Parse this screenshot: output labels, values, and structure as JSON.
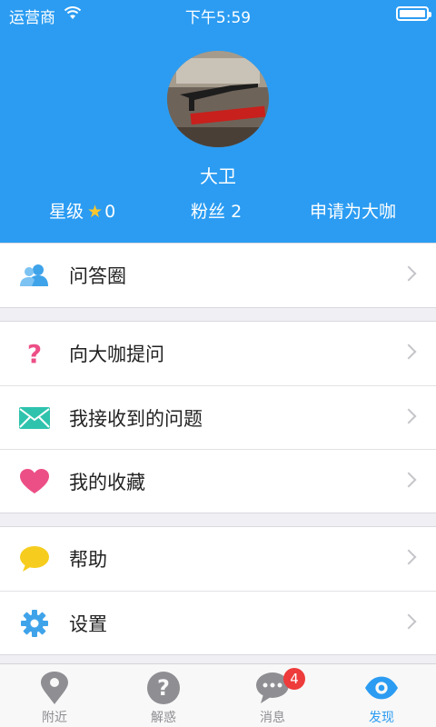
{
  "status_bar": {
    "carrier": "运营商",
    "time": "下午5:59"
  },
  "profile": {
    "name": "大卫",
    "level_label": "星级",
    "level_value": "0",
    "fans_label": "粉丝",
    "fans_value": "2",
    "apply_label": "申请为大咖"
  },
  "menu": {
    "group1": [
      {
        "label": "问答圈",
        "icon": "users-icon"
      }
    ],
    "group2": [
      {
        "label": "向大咖提问",
        "icon": "question-mark-icon"
      },
      {
        "label": "我接收到的问题",
        "icon": "envelope-icon"
      },
      {
        "label": "我的收藏",
        "icon": "heart-icon"
      }
    ],
    "group3": [
      {
        "label": "帮助",
        "icon": "speech-bubble-icon"
      },
      {
        "label": "设置",
        "icon": "gear-icon"
      }
    ]
  },
  "tabs": [
    {
      "label": "附近",
      "icon": "location-pin-icon"
    },
    {
      "label": "解惑",
      "icon": "question-circle-icon"
    },
    {
      "label": "消息",
      "icon": "chat-bubble-icon",
      "badge": "4"
    },
    {
      "label": "发现",
      "icon": "eye-icon",
      "active": true
    }
  ],
  "colors": {
    "primary": "#2b9cf2",
    "badge": "#ee3b3b",
    "star": "#f8c62f"
  }
}
